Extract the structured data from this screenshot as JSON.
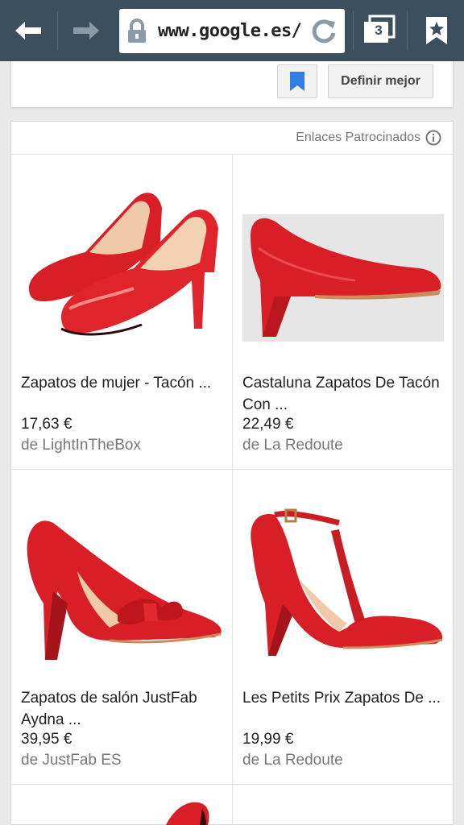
{
  "browser": {
    "url": "www.google.es/",
    "tab_count": "3",
    "icons": {
      "back": "arrow-left-icon",
      "forward": "arrow-right-icon",
      "lock": "lock-icon",
      "reload": "reload-icon",
      "tabs": "tabs-icon",
      "bookmark": "bookmark-star-icon"
    }
  },
  "top_card": {
    "refine_label": "Definir mejor",
    "bookmark_icon": "bookmark-icon"
  },
  "shopping": {
    "sponsored_label": "Enlaces Patrocinados",
    "products": [
      {
        "title": "Zapatos de mujer - Tacón ...",
        "price": "17,63 €",
        "seller": "de LightInTheBox"
      },
      {
        "title": "Castaluna Zapatos De Tacón Con ...",
        "price": "22,49 €",
        "seller": "de La Redoute"
      },
      {
        "title": "Zapatos de salón JustFab Aydna ...",
        "price": "39,95 €",
        "seller": "de JustFab ES"
      },
      {
        "title": "Les Petits Prix Zapatos De ...",
        "price": "19,99 €",
        "seller": "de La Redoute"
      }
    ]
  },
  "colors": {
    "toolbar": "#3b4f5e",
    "shoe_red": "#d81e26",
    "bookmark_blue": "#2f7fe0"
  }
}
